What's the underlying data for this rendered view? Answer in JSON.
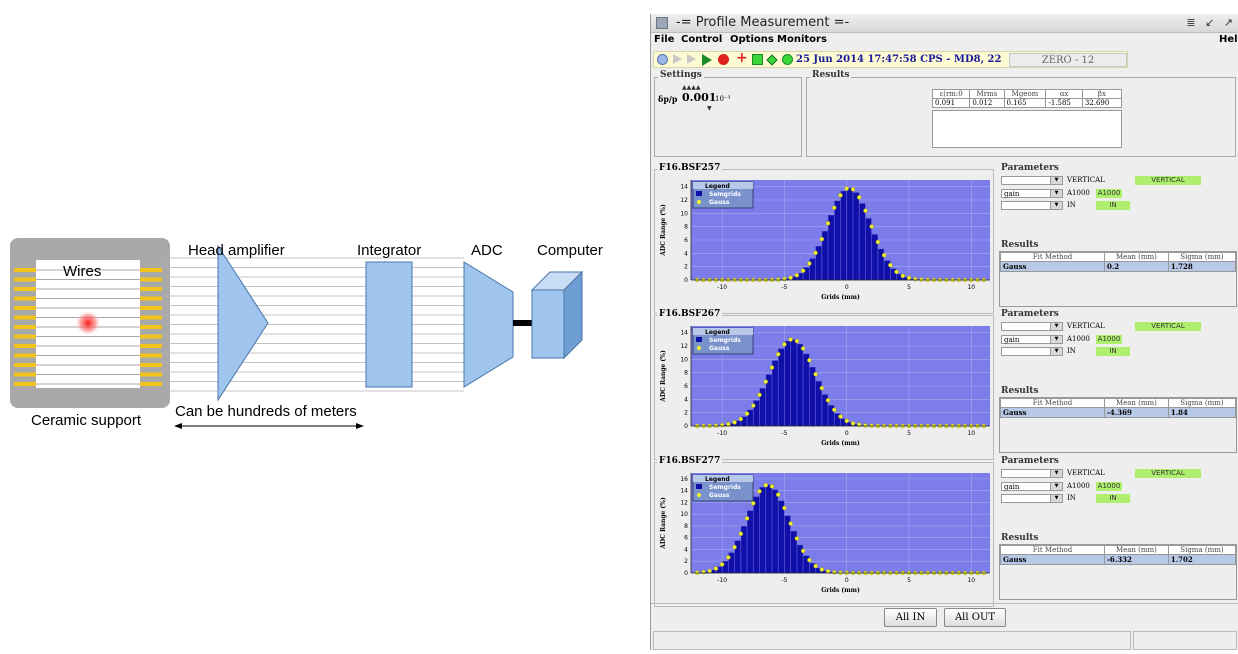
{
  "diagram": {
    "wires_label": "Wires",
    "ceramic_label": "Ceramic support",
    "amp_label": "Head amplifier",
    "integrator_label": "Integrator",
    "adc_label": "ADC",
    "computer_label": "Computer",
    "distance_label": "Can be hundreds of meters"
  },
  "window": {
    "title": "-= Profile Measurement =-",
    "menu": [
      "File",
      "Control",
      "Options",
      "Monitors"
    ],
    "help": "Help",
    "toolbar_date": "25 Jun 2014  17:47:58  CPS - MD8, 22",
    "zero_field": "ZERO - 12"
  },
  "settings": {
    "title": "Settings",
    "label": "δp/p",
    "value": "0.001",
    "exp": "10⁻³"
  },
  "top_results": {
    "title": "Results",
    "headers": [
      "ε(rm:0",
      "Mrms",
      "Mgeom",
      "αx",
      "βx"
    ],
    "values": [
      "0.091",
      "0.012",
      "0.165",
      "-1.585",
      "32.690"
    ]
  },
  "monitors": [
    {
      "name": "F16.BSF257",
      "params_title": "Parameters",
      "plane": "VERTICAL",
      "plane_state": "VERTICAL",
      "gain": "gain",
      "gain_value": "A1000",
      "gain_state": "A1000",
      "in_value": "IN",
      "in_state": "IN",
      "results_title": "Results",
      "fit_headers": [
        "Fit Method",
        "Mean (mm)",
        "Sigma (mm)"
      ],
      "fit_row": [
        "Gauss",
        "0.2",
        "1.728"
      ],
      "legend_title": "Legend",
      "legend_items": [
        "Semgrids",
        "Gauss"
      ],
      "xlabel": "Grids (mm)",
      "ylabel": "ADC Range (%)",
      "xticks": [
        "-10",
        "-5",
        "0",
        "5",
        "10"
      ],
      "yticks": [
        "0",
        "2",
        "4",
        "6",
        "8",
        "10",
        "12",
        "14"
      ],
      "ymax": 15,
      "mean": 0.2,
      "sigma": 1.728,
      "amplitude": 13.8
    },
    {
      "name": "F16.BSF267",
      "params_title": "Parameters",
      "plane": "VERTICAL",
      "plane_state": "VERTICAL",
      "gain": "gain",
      "gain_value": "A1000",
      "gain_state": "A1000",
      "in_value": "IN",
      "in_state": "IN",
      "results_title": "Results",
      "fit_headers": [
        "Fit Method",
        "Mean (mm)",
        "Sigma (mm)"
      ],
      "fit_row": [
        "Gauss",
        "-4.369",
        "1.84"
      ],
      "legend_title": "Legend",
      "legend_items": [
        "Semgrids",
        "Gauss"
      ],
      "xlabel": "Grids (mm)",
      "ylabel": "ADC Range (%)",
      "xticks": [
        "-10",
        "-5",
        "0",
        "5",
        "10"
      ],
      "yticks": [
        "0",
        "2",
        "4",
        "6",
        "8",
        "10",
        "12",
        "14"
      ],
      "ymax": 15,
      "mean": -4.369,
      "sigma": 1.84,
      "amplitude": 13.0
    },
    {
      "name": "F16.BSF277",
      "params_title": "Parameters",
      "plane": "VERTICAL",
      "plane_state": "VERTICAL",
      "gain": "gain",
      "gain_value": "A1000",
      "gain_state": "A1000",
      "in_value": "IN",
      "in_state": "IN",
      "results_title": "Results",
      "fit_headers": [
        "Fit Method",
        "Mean (mm)",
        "Sigma (mm)"
      ],
      "fit_row": [
        "Gauss",
        "-6.332",
        "1.702"
      ],
      "legend_title": "Legend",
      "legend_items": [
        "Semgrids",
        "Gauss"
      ],
      "xlabel": "Grids (mm)",
      "ylabel": "ADC Range (%)",
      "xticks": [
        "-10",
        "-5",
        "0",
        "5",
        "10"
      ],
      "yticks": [
        "0",
        "2",
        "4",
        "6",
        "8",
        "10",
        "12",
        "14",
        "16"
      ],
      "ymax": 17,
      "mean": -6.332,
      "sigma": 1.702,
      "amplitude": 15.0
    }
  ],
  "buttons": {
    "all_in": "All IN",
    "all_out": "All OUT"
  },
  "colors": {
    "plot_bg": "#7c7cea",
    "bar": "#1010a8",
    "fit_point": "#f4f42a",
    "accent_green": "#aef06e"
  }
}
